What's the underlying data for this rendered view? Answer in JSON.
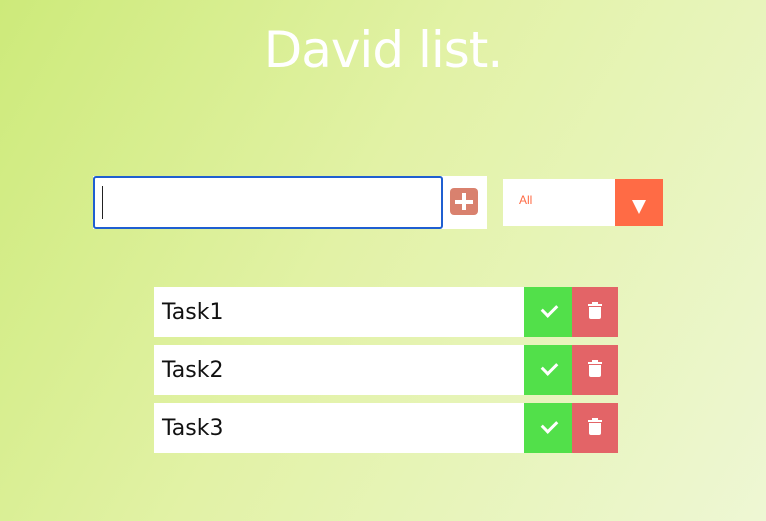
{
  "header": {
    "title": "David list."
  },
  "form": {
    "input_value": "",
    "filter_selected": "All",
    "accent_color": "#ff6b45",
    "add_icon": "plus-square-icon",
    "filter_icon": "caret-down-icon"
  },
  "todos": [
    {
      "text": "Task1",
      "complete_icon": "check-icon",
      "delete_icon": "trash-icon"
    },
    {
      "text": "Task2",
      "complete_icon": "check-icon",
      "delete_icon": "trash-icon"
    },
    {
      "text": "Task3",
      "complete_icon": "check-icon",
      "delete_icon": "trash-icon"
    }
  ],
  "colors": {
    "complete": "#52e04a",
    "delete": "#e36467",
    "input_focus_border": "#1f5fd1"
  }
}
